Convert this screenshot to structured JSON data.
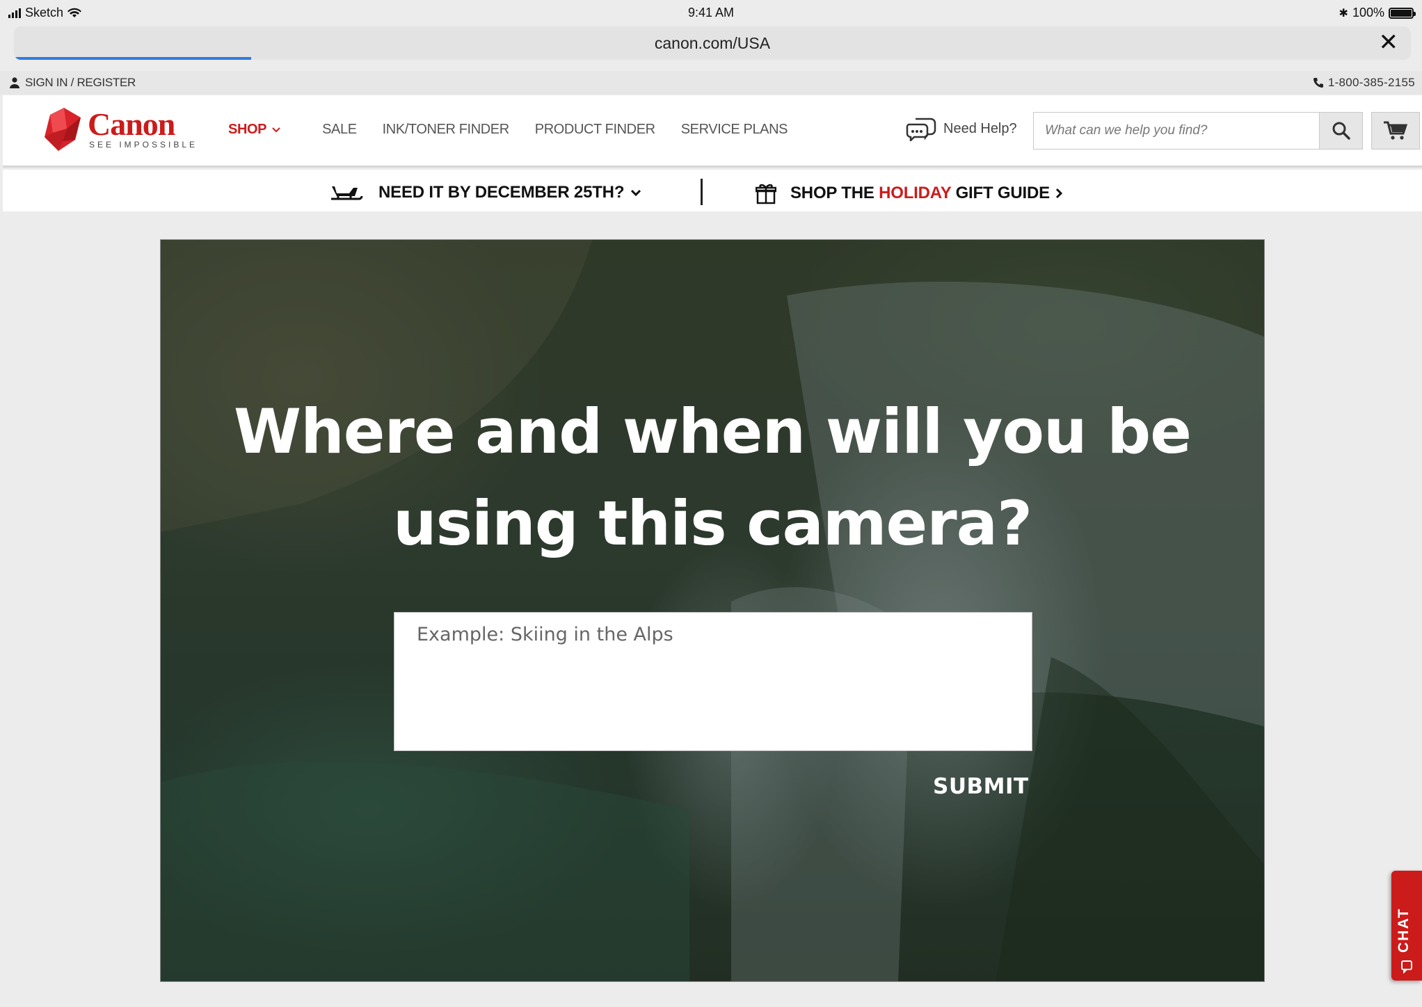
{
  "status_bar": {
    "carrier": "Sketch",
    "time": "9:41 AM",
    "battery": "100%"
  },
  "browser": {
    "url": "canon.com/USA",
    "load_progress": 0.17
  },
  "utility_bar": {
    "signin_label": "SIGN IN / REGISTER",
    "phone": "1-800-385-2155"
  },
  "header": {
    "logo_word": "Canon",
    "logo_tagline": "SEE IMPOSSIBLE",
    "nav": {
      "shop": "SHOP",
      "sale": "SALE",
      "ink_toner": "INK/TONER FINDER",
      "product_finder": "PRODUCT FINDER",
      "service_plans": "SERVICE PLANS"
    },
    "need_help": "Need Help?",
    "search_placeholder": "What can we help you find?"
  },
  "promo": {
    "left": "NEED IT BY DECEMBER 25TH?",
    "right_prefix": "SHOP THE",
    "right_highlight": "HOLIDAY",
    "right_suffix": "GIFT GUIDE"
  },
  "hero": {
    "title": "Where and when will you be using this camera?",
    "input_placeholder": "Example: Skiing in the Alps",
    "submit_label": "SUBMIT"
  },
  "chat": {
    "label": "CHAT"
  },
  "colors": {
    "brand_red": "#cc1b1b",
    "progress_blue": "#2f7de1"
  }
}
